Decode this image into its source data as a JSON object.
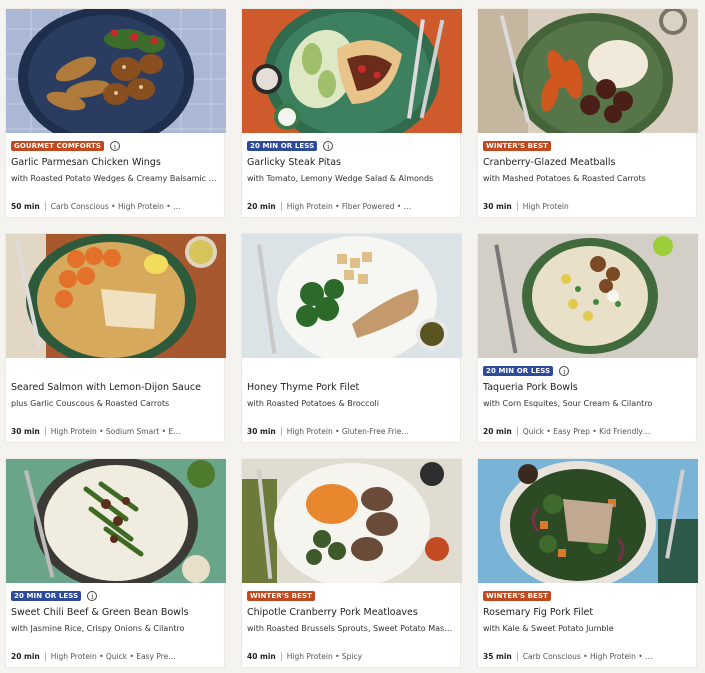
{
  "recipes": [
    {
      "badge": "GOURMET COMFORTS",
      "badge_type": "gourmet",
      "show_info": true,
      "title": "Garlic Parmesan Chicken Wings",
      "subtitle": "with Roasted Potato Wedges & Creamy Balsamic Gr…",
      "time": "50 min",
      "tags": "Carb Conscious • High Protein • …"
    },
    {
      "badge": "20 MIN OR LESS",
      "badge_type": "fast",
      "show_info": true,
      "title": "Garlicky Steak Pitas",
      "subtitle": "with Tomato, Lemony Wedge Salad & Almonds",
      "time": "20 min",
      "tags": "High Protein • Fiber Powered • …"
    },
    {
      "badge": "WINTER'S BEST",
      "badge_type": "winter",
      "show_info": false,
      "title": "Cranberry-Glazed Meatballs",
      "subtitle": "with Mashed Potatoes & Roasted Carrots",
      "time": "30 min",
      "tags": "High Protein"
    },
    {
      "badge": "",
      "badge_type": "",
      "show_info": false,
      "title": "Seared Salmon with Lemon-Dijon Sauce",
      "subtitle": "plus Garlic Couscous & Roasted Carrots",
      "time": "30 min",
      "tags": "High Protein • Sodium Smart • E…"
    },
    {
      "badge": "",
      "badge_type": "",
      "show_info": false,
      "title": "Honey Thyme Pork Filet",
      "subtitle": "with Roasted Potatoes & Broccoli",
      "time": "30 min",
      "tags": "High Protein • Gluten-Free Frie…"
    },
    {
      "badge": "20 MIN OR LESS",
      "badge_type": "fast",
      "show_info": true,
      "title": "Taqueria Pork Bowls",
      "subtitle": "with Corn Esquites, Sour Cream & Cilantro",
      "time": "20 min",
      "tags": "Quick • Easy Prep • Kid Friendly…"
    },
    {
      "badge": "20 MIN OR LESS",
      "badge_type": "fast",
      "show_info": true,
      "title": "Sweet Chili Beef & Green Bean Bowls",
      "subtitle": "with Jasmine Rice, Crispy Onions & Cilantro",
      "time": "20 min",
      "tags": "High Protein • Quick • Easy Pre…"
    },
    {
      "badge": "WINTER'S BEST",
      "badge_type": "winter",
      "show_info": false,
      "title": "Chipotle Cranberry Pork Meatloaves",
      "subtitle": "with Roasted Brussels Sprouts, Sweet Potato Mash & …",
      "time": "40 min",
      "tags": "High Protein • Spicy"
    },
    {
      "badge": "WINTER'S BEST",
      "badge_type": "winter",
      "show_info": false,
      "title": "Rosemary Fig Pork Filet",
      "subtitle": "with Kale & Sweet Potato Jumble",
      "time": "35 min",
      "tags": "Carb Conscious • High Protein • …"
    }
  ],
  "info_glyph": "i",
  "colors": {
    "gourmet": "#c2481d",
    "fast": "#2d4a9b",
    "winter": "#c2481d"
  }
}
